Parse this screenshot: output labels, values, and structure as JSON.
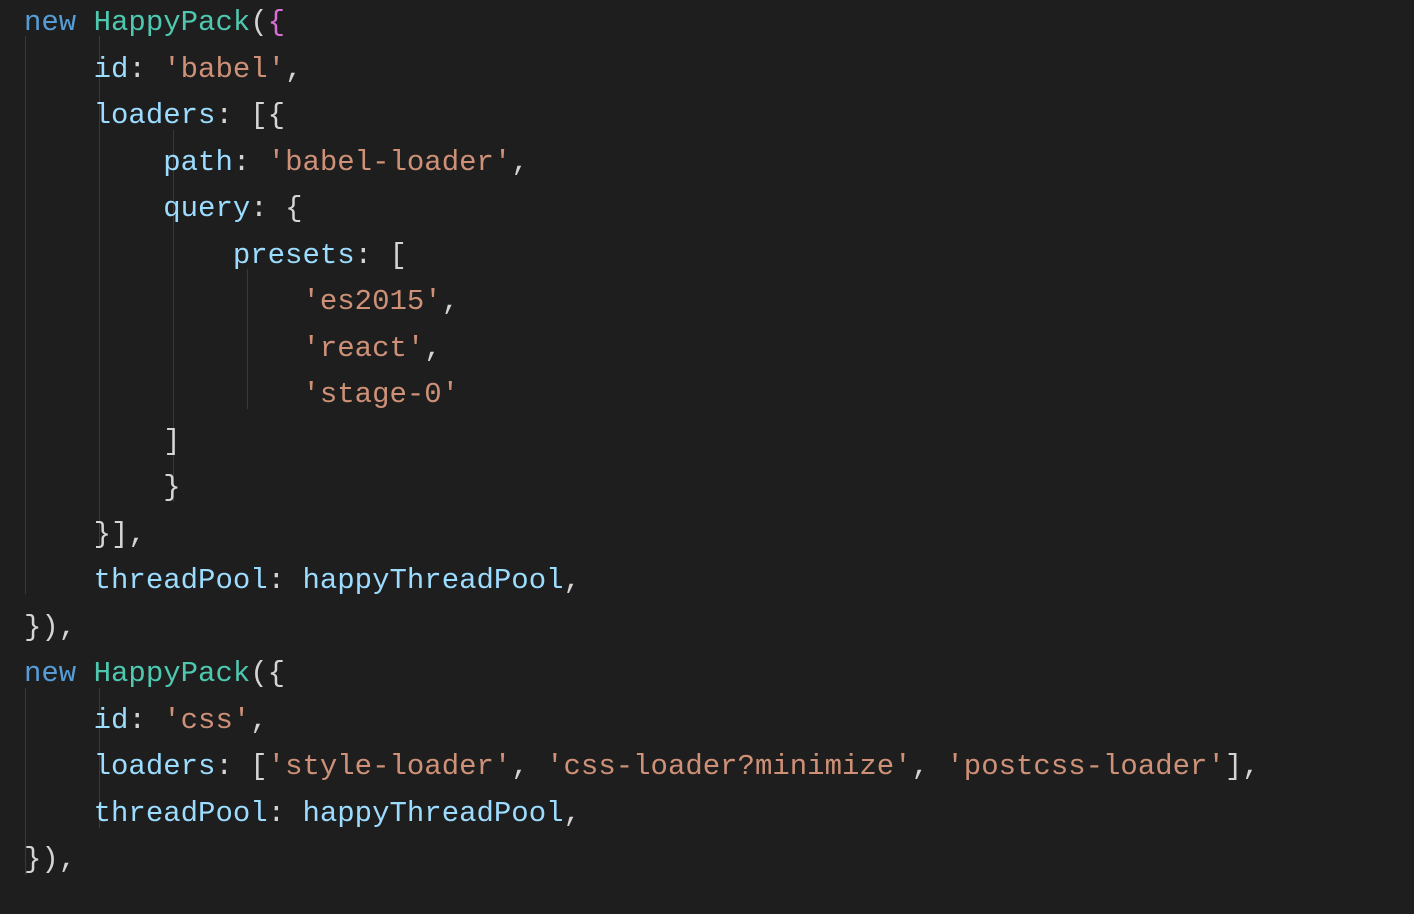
{
  "code": {
    "line1": {
      "kw": "new",
      "cls": "HappyPack",
      "open": "(",
      "brace": "{"
    },
    "line2": {
      "indent": "    ",
      "prop": "id",
      "colon": ":",
      "sp": " ",
      "str": "'babel'",
      "comma": ","
    },
    "line3": {
      "indent": "    ",
      "prop": "loaders",
      "colon": ":",
      "sp": " ",
      "arr": "[{"
    },
    "line4": {
      "indent": "        ",
      "prop": "path",
      "colon": ":",
      "sp": " ",
      "str": "'babel-loader'",
      "comma": ","
    },
    "line5": {
      "indent": "        ",
      "prop": "query",
      "colon": ":",
      "sp": " ",
      "brace": "{"
    },
    "line6": {
      "indent": "            ",
      "prop": "presets",
      "colon": ":",
      "sp": " ",
      "arr": "["
    },
    "line7": {
      "indent": "                ",
      "str": "'es2015'",
      "comma": ","
    },
    "line8": {
      "indent": "                ",
      "str": "'react'",
      "comma": ","
    },
    "line9": {
      "indent": "                ",
      "str": "'stage-0'"
    },
    "line10": {
      "indent": "        ",
      "close": "]"
    },
    "line11": {
      "indent": "        ",
      "close": "}"
    },
    "line12": {
      "indent": "    ",
      "close": "}],"
    },
    "line13": {
      "indent": "    ",
      "prop": "threadPool",
      "colon": ":",
      "sp": " ",
      "var": "happyThreadPool",
      "comma": ","
    },
    "line14": {
      "close": "}),"
    },
    "line15": {
      "kw": "new",
      "cls": "HappyPack",
      "open": "({"
    },
    "line16": {
      "indent": "    ",
      "prop": "id",
      "colon": ":",
      "sp": " ",
      "str": "'css'",
      "comma": ","
    },
    "line17": {
      "indent": "    ",
      "prop": "loaders",
      "colon": ":",
      "sp": " ",
      "arr_open": "[",
      "s1": "'style-loader'",
      "c1": ", ",
      "s2": "'css-loader?minimize'",
      "c2": ", ",
      "s3": "'postcss-loader'",
      "arr_close": "],"
    },
    "line18": {
      "indent": "    ",
      "prop": "threadPool",
      "colon": ":",
      "sp": " ",
      "var": "happyThreadPool",
      "comma": ","
    },
    "line19": {
      "close": "}),"
    }
  }
}
